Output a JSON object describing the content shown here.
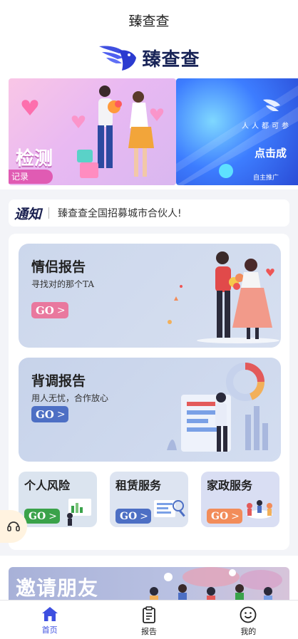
{
  "app": {
    "title": "臻查查",
    "brand": "臻查查"
  },
  "banner": {
    "slide1": {
      "big_text": "检测",
      "pill_text": "记录"
    },
    "slide2": {
      "line1": "人人都可参",
      "line2": "点击成",
      "line3": "自主推广"
    }
  },
  "notice": {
    "label": "通知",
    "message": "臻查查全国招募城市合伙人!"
  },
  "cards": {
    "couple": {
      "title": "情侣报告",
      "subtitle": "寻找对的那个TA",
      "go": "GO"
    },
    "background": {
      "title": "背调报告",
      "subtitle": "用人无忧，合作放心",
      "go": "GO"
    }
  },
  "small_cards": [
    {
      "title": "个人风险",
      "go": "GO"
    },
    {
      "title": "租赁服务",
      "go": "GO"
    },
    {
      "title": "家政服务",
      "go": "GO"
    }
  ],
  "invite": {
    "text": "邀请朋友"
  },
  "tabs": [
    {
      "label": "首页",
      "icon": "home-icon",
      "active": true
    },
    {
      "label": "报告",
      "icon": "clipboard-icon",
      "active": false
    },
    {
      "label": "我的",
      "icon": "smiley-icon",
      "active": false
    }
  ],
  "colors": {
    "accent": "#3d4fe0",
    "go_pink": "#e9789e",
    "go_blue": "#4d6fc4",
    "go_green": "#3aa24a",
    "go_orange": "#f28c5a"
  }
}
